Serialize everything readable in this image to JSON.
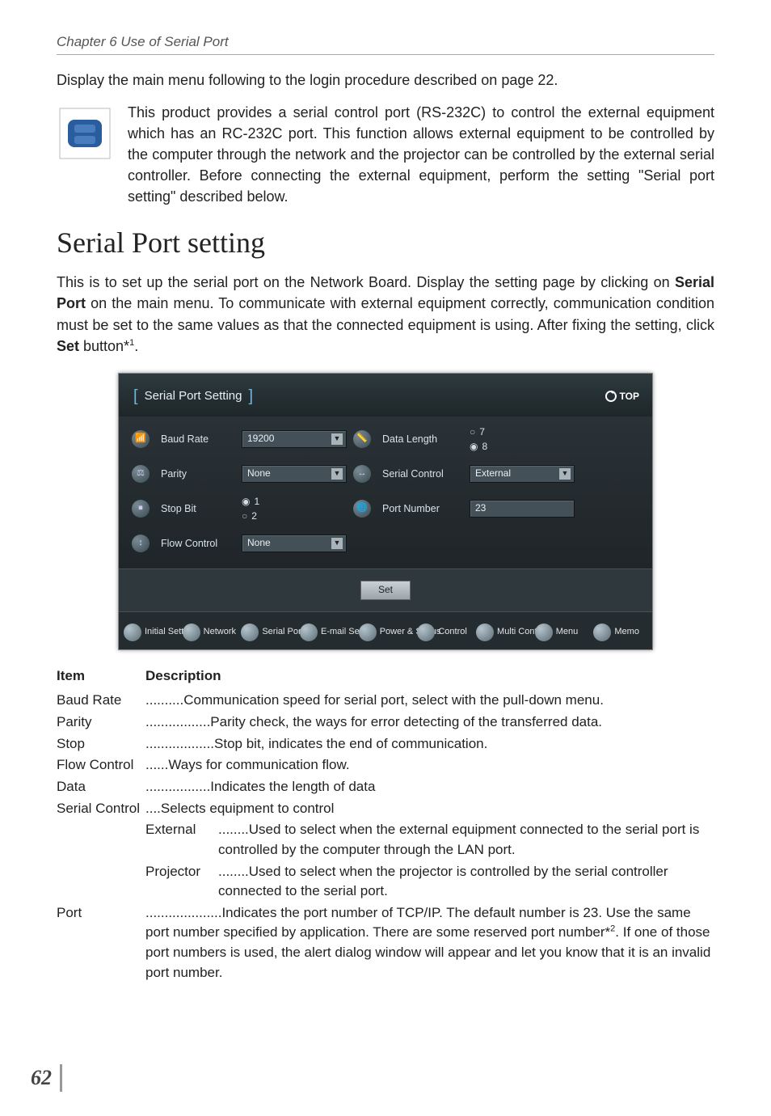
{
  "chapter_header": "Chapter 6 Use of Serial Port",
  "intro1": "Display the main menu following to the login procedure described on page 22.",
  "intro2": "This product provides a serial control port (RS-232C) to control the external equipment which has an RC-232C port. This function allows external equipment to be controlled by the computer through the network and the projector can be controlled by the external serial controller. Before connecting the external equipment, perform the setting \"Serial port setting\" described below.",
  "heading": "Serial Port setting",
  "body1_a": "This is to set up the serial port on the Network Board. Display the setting page by clicking on ",
  "body1_b_bold": "Serial Port",
  "body1_c": " on the main menu. To communicate with external equipment correctly, communication condition must be set to the same values as that the connected equipment is using. After fixing the setting, click ",
  "body1_d_bold": "Set",
  "body1_e": " button*",
  "body1_sup": "1",
  "body1_f": ".",
  "scr": {
    "title": "Serial Port Setting",
    "top": "TOP",
    "baud_rate_label": "Baud Rate",
    "baud_rate_value": "19200",
    "parity_label": "Parity",
    "parity_value": "None",
    "stop_bit_label": "Stop Bit",
    "stop_bit_1": "1",
    "stop_bit_2": "2",
    "flow_label": "Flow Control",
    "flow_value": "None",
    "data_len_label": "Data Length",
    "data_len_7": "7",
    "data_len_8": "8",
    "serial_ctrl_label": "Serial Control",
    "serial_ctrl_value": "External",
    "port_label": "Port Number",
    "port_value": "23",
    "set_btn": "Set",
    "tabs": [
      "Initial Setting",
      "Network",
      "Serial Port",
      "E-mail Setting",
      "Power & Status",
      "Control",
      "Multi Control",
      "Menu",
      "Memo"
    ]
  },
  "def_hdr_item": "Item",
  "def_hdr_desc": "Description",
  "defs": {
    "baud_rate_t": "Baud Rate",
    "baud_rate_d": "..........Communication speed for serial port, select with the pull-down menu.",
    "parity_t": "Parity",
    "parity_d": ".................Parity check, the ways for error detecting of the transferred data.",
    "stop_t": "Stop ",
    "stop_d": "..................Stop bit, indicates the end of communication.",
    "flow_t": "Flow Control ",
    "flow_d": "......Ways for communication flow.",
    "data_t": "Data ",
    "data_d": ".................Indicates the length of data",
    "sc_t": "Serial Control ",
    "sc_d": "....Selects equipment to control",
    "ext_t": "External ",
    "ext_d": "........Used to select when the external equipment connected to the serial port is controlled by the computer through the LAN port.",
    "proj_t": "Projector",
    "proj_d": "........Used to select when the projector is controlled by the serial controller connected to the serial port.",
    "port_t": "Port",
    "port_d_a": "....................Indicates the port number of TCP/IP. The default number is 23. Use the same port number specified by application. There are some reserved port number*",
    "port_sup": "2",
    "port_d_b": ". If one of those port numbers is used, the alert dialog window will appear and let you know that it is an invalid port number."
  },
  "page_number": "62"
}
